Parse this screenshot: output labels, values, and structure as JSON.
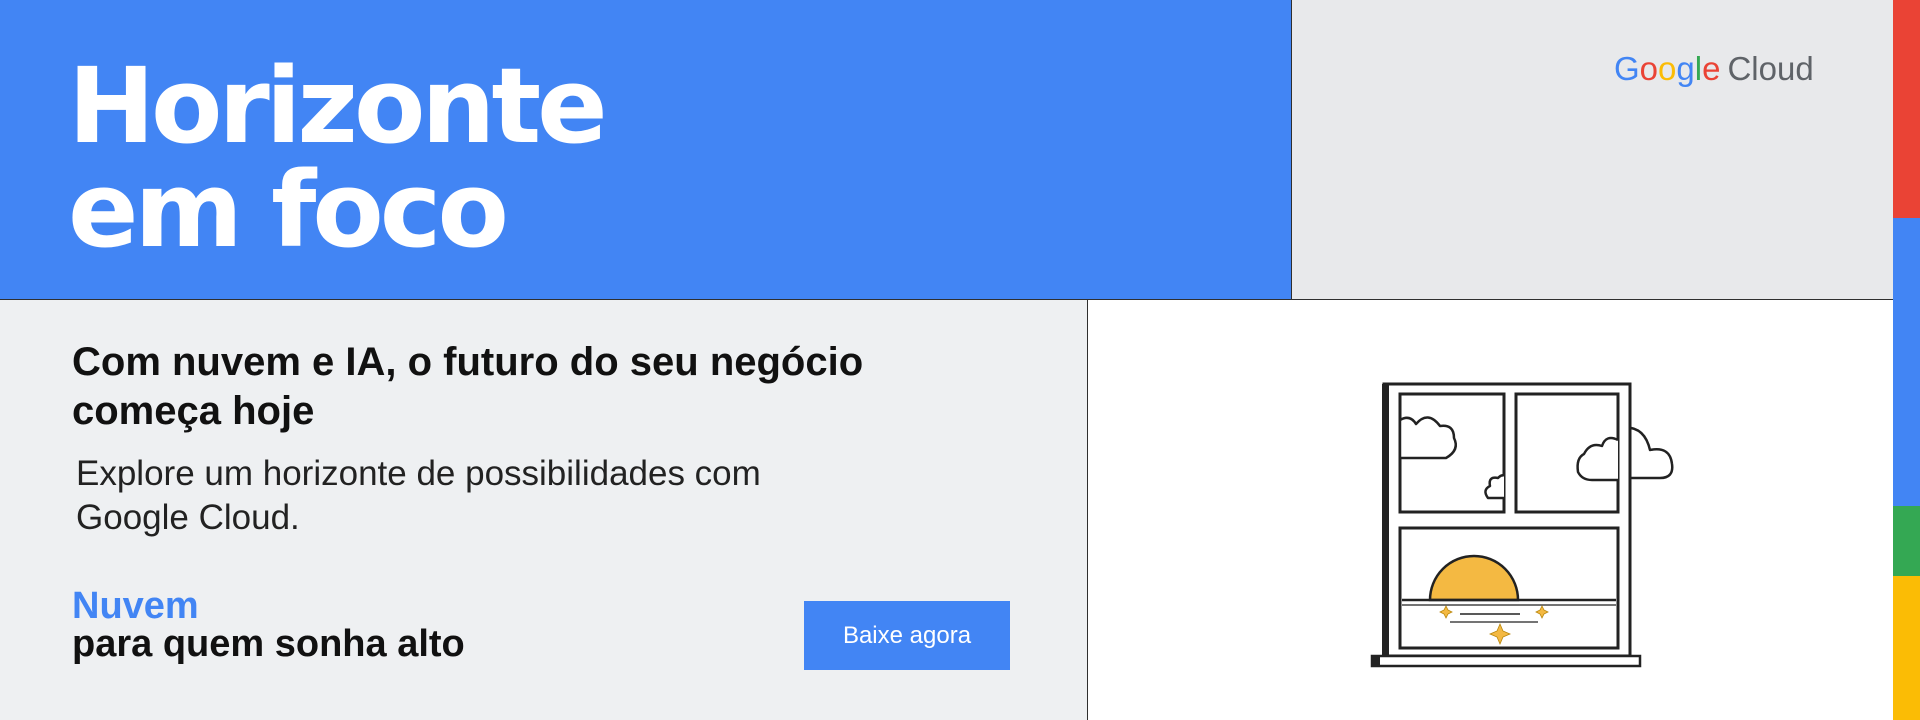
{
  "hero": {
    "title_line1": "Horizonte",
    "title_line2": "em foco"
  },
  "logo": {
    "google_letters": [
      "G",
      "o",
      "o",
      "g",
      "l",
      "e"
    ],
    "cloud": "Cloud"
  },
  "content": {
    "headline": "Com nuvem e IA, o futuro do seu negócio começa hoje",
    "subheadline": "Explore um horizonte de possibilidades com Google Cloud.",
    "tagline_accent": "Nuvem",
    "tagline": "para quem sonha alto"
  },
  "cta": {
    "label": "Baixe agora"
  },
  "illustration": {
    "icon": "window-sunset-icon",
    "elements": [
      "window-frame",
      "cloud",
      "sun",
      "sea",
      "sparkles"
    ]
  },
  "colors": {
    "brand_blue": "#4285f4",
    "google_red": "#ea4335",
    "google_yellow": "#fbbc05",
    "google_green": "#34a853",
    "sun": "#f4b942",
    "dark_outline": "#222222"
  }
}
